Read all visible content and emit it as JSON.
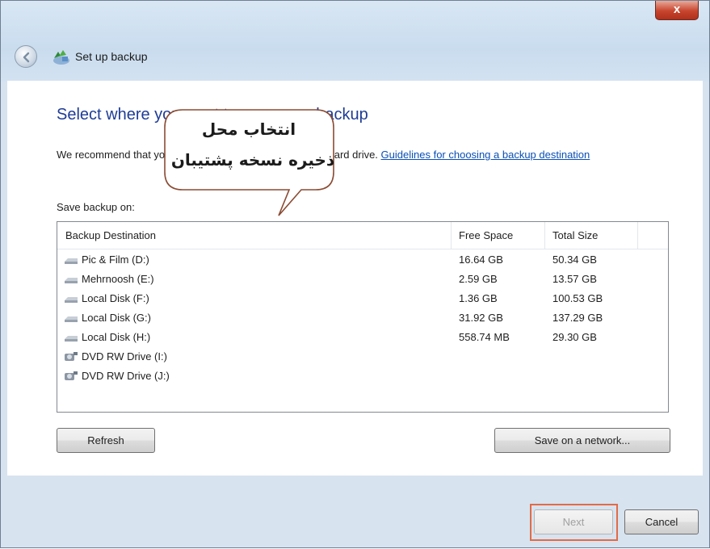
{
  "window": {
    "title": "Set up backup",
    "close_glyph": "x"
  },
  "page": {
    "heading": "Select where you want to save your backup",
    "intro_text": "We recommend that you save your backup on an external hard drive.",
    "intro_text_visible": "We recommend t",
    "intro_text_visible_after": "an external hard drive.",
    "guidelines_link": "Guidelines for choosing a backup destination",
    "save_label": "Save backup on:"
  },
  "callout": {
    "line1": "انتخاب محل",
    "line2": "ذخیره نسخه پشتیبان"
  },
  "table": {
    "columns": [
      "Backup Destination",
      "Free Space",
      "Total Size"
    ],
    "rows": [
      {
        "name": "Pic & Film (D:)",
        "free": "16.64 GB",
        "total": "50.34 GB",
        "icon": "hard-drive-icon"
      },
      {
        "name": "Mehrnoosh (E:)",
        "free": "2.59 GB",
        "total": "13.57 GB",
        "icon": "hard-drive-icon"
      },
      {
        "name": "Local Disk (F:)",
        "free": "1.36 GB",
        "total": "100.53 GB",
        "icon": "hard-drive-icon"
      },
      {
        "name": "Local Disk (G:)",
        "free": "31.92 GB",
        "total": "137.29 GB",
        "icon": "hard-drive-icon"
      },
      {
        "name": "Local Disk (H:)",
        "free": "558.74 MB",
        "total": "29.30 GB",
        "icon": "hard-drive-icon"
      },
      {
        "name": "DVD RW Drive (I:)",
        "free": "",
        "total": "",
        "icon": "dvd-drive-icon"
      },
      {
        "name": "DVD RW Drive (J:)",
        "free": "",
        "total": "",
        "icon": "dvd-drive-icon"
      }
    ]
  },
  "buttons": {
    "refresh": "Refresh",
    "save_network": "Save on a network...",
    "next": "Next",
    "cancel": "Cancel"
  },
  "colors": {
    "heading": "#1e3c96",
    "link": "#0a4fb5",
    "highlight": "#e36a46",
    "close": "#c7442d"
  }
}
